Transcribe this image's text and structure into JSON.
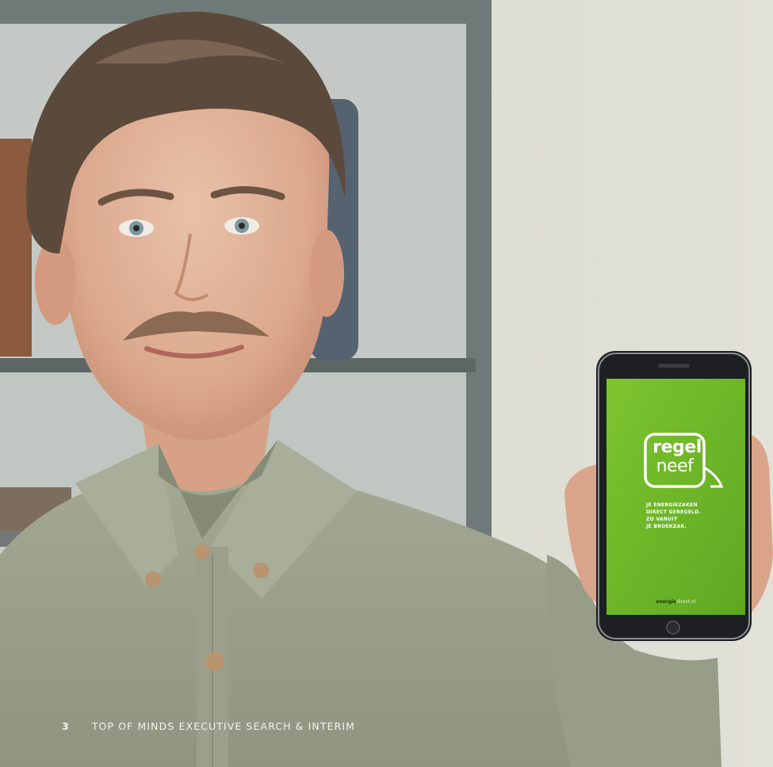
{
  "photo": {
    "subject": "man-holding-smartphone",
    "colors": {
      "wall": "#dcdcd2",
      "shirt": "#9ea48e",
      "screen": "#71b82a"
    }
  },
  "phone_screen": {
    "logo_line1": "regel",
    "logo_line2": "neef",
    "tagline": [
      "JE ENERGIEZAKEN",
      "DIRECT GEREGELD.",
      "ZO VANUIT",
      "JE BROEKZAK."
    ],
    "brand_part1": "energie",
    "brand_part2": "direct.nl"
  },
  "footer": {
    "page_number": "3",
    "company": "TOP OF MINDS EXECUTIVE SEARCH & INTERIM"
  }
}
